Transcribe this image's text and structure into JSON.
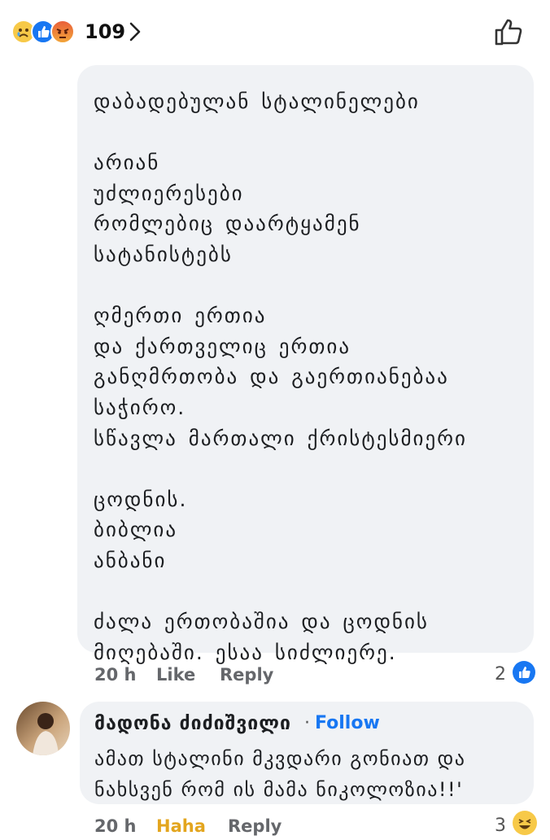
{
  "top_bar": {
    "reactions": [
      "sad",
      "like",
      "angry"
    ],
    "count": "109"
  },
  "comment": {
    "lines": [
      "დაბადებულან სტალინელები",
      "",
      "არიან",
      "უძლიერესები",
      "რომლებიც დაარტყამენ",
      "სატანისტებს",
      "",
      "ღმერთი ერთია",
      "და ქართველიც ერთია",
      "განღმრთობა და გაერთიანებაა",
      "საჭირო.",
      "სწავლა მართალი  ქრისტესმიერი",
      "",
      "ცოდნის.",
      "ბიბლია",
      "ანბანი",
      "",
      "ძალა ერთობაშია და ცოდნის",
      "მიღებაში. ესაა სიძლიერე."
    ],
    "time": "20 h",
    "like_label": "Like",
    "reply_label": "Reply",
    "reaction_count": "2",
    "reaction_type": "like"
  },
  "reply": {
    "author": "მადონა ძიძიშვილი",
    "separator": "·",
    "follow_label": "Follow",
    "lines": [
      "ამათ სტალინი მკვდარი გონიათ და",
      "ნახსვენ რომ ის მამა ნიკოლოზია!!'"
    ],
    "time": "20 h",
    "reaction_label": "Haha",
    "reply_label": "Reply",
    "reaction_count": "3",
    "reaction_type": "haha"
  },
  "colors": {
    "bubble": "#f0f2f5",
    "link_blue": "#1877f2",
    "meta_gray": "#65676b",
    "haha_yellow": "#e3a51e"
  }
}
